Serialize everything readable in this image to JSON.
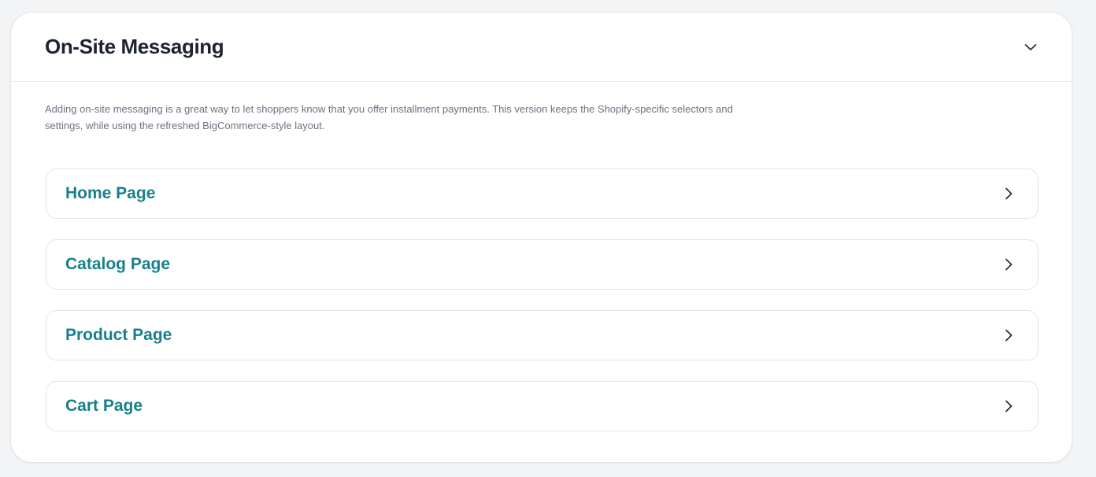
{
  "panel": {
    "title": "On-Site Messaging",
    "toggle_icon": "chevron-down-icon",
    "description": "Adding on-site messaging is a great way to let shoppers know that you offer installment payments. This version keeps the Shopify-specific selectors and settings, while using the refreshed BigCommerce-style layout.",
    "accent_color": "#17808a",
    "sections": [
      {
        "label": "Home Page",
        "icon": "chevron-right-icon"
      },
      {
        "label": "Catalog Page",
        "icon": "chevron-right-icon"
      },
      {
        "label": "Product Page",
        "icon": "chevron-right-icon"
      },
      {
        "label": "Cart Page",
        "icon": "chevron-right-icon"
      }
    ]
  }
}
